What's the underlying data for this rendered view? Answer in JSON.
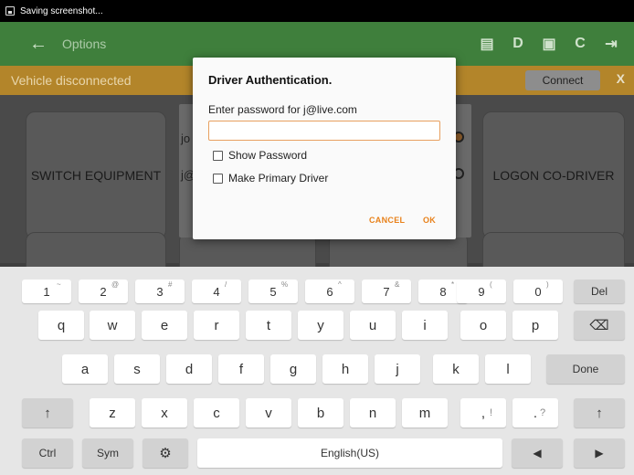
{
  "status_bar": {
    "text": "Saving screenshot..."
  },
  "app_bar": {
    "back_glyph": "←",
    "title": "Options",
    "actions": [
      "▤",
      "D",
      "▣",
      "C",
      "⇥"
    ]
  },
  "banner": {
    "message": "Vehicle disconnected",
    "connect_label": "Connect",
    "close_label": "X"
  },
  "tiles": {
    "switch_equipment": "SWITCH EQUIPMENT",
    "logon_codriver": "LOGON CO-DRIVER"
  },
  "background_list": {
    "row1": "jo",
    "row2": "j@"
  },
  "dialog": {
    "title": "Driver Authentication.",
    "prompt": "Enter password for j@live.com",
    "password_value": "",
    "show_password_label": "Show Password",
    "primary_driver_label": "Make Primary Driver",
    "cancel_label": "CANCEL",
    "ok_label": "OK"
  },
  "keyboard": {
    "number_row": [
      {
        "k": "1",
        "s": "~"
      },
      {
        "k": "2",
        "s": "@"
      },
      {
        "k": "3",
        "s": "#"
      },
      {
        "k": "4",
        "s": "/"
      },
      {
        "k": "5",
        "s": "%"
      },
      {
        "k": "6",
        "s": "^"
      },
      {
        "k": "7",
        "s": "&"
      },
      {
        "k": "8",
        "s": "*"
      },
      {
        "k": "9",
        "s": "("
      },
      {
        "k": "0",
        "s": ")"
      }
    ],
    "del_label": "Del",
    "row1": [
      "q",
      "w",
      "e",
      "r",
      "t",
      "y",
      "u",
      "i",
      "o",
      "p"
    ],
    "row2": [
      "a",
      "s",
      "d",
      "f",
      "g",
      "h",
      "j",
      "k",
      "l"
    ],
    "row3": [
      "z",
      "x",
      "c",
      "v",
      "b",
      "n",
      "m"
    ],
    "punct1": ",",
    "punct1_sup": "!",
    "punct2": ".",
    "punct2_sup": "?",
    "done_label": "Done",
    "shift_glyph": "↑",
    "backspace_glyph": "⌫",
    "ctrl_label": "Ctrl",
    "sym_label": "Sym",
    "settings_glyph": "⚙",
    "space_label": "English(US)",
    "left_glyph": "◀",
    "right_glyph": "▶"
  },
  "colors": {
    "app_bar": "#3f7f3c",
    "banner": "#b3852a",
    "accent": "#e8811a"
  }
}
